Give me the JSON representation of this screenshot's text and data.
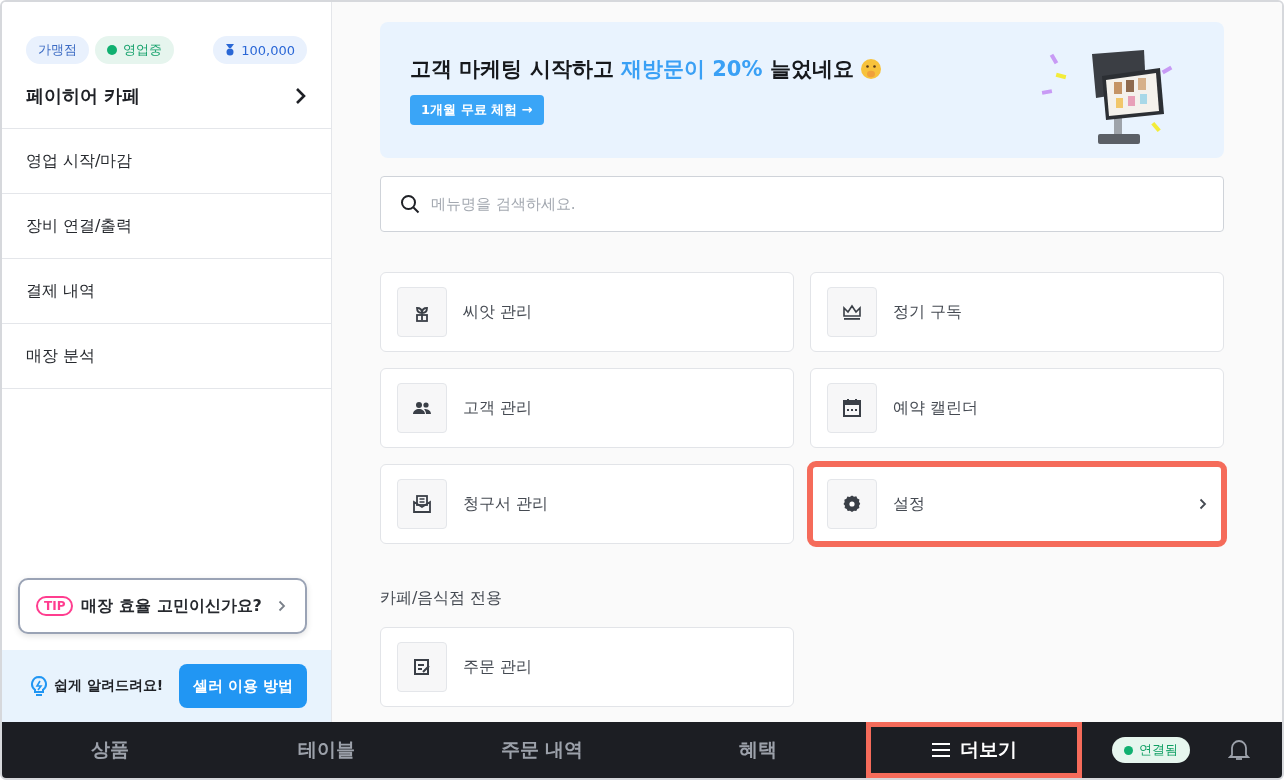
{
  "sidebar": {
    "store_type": "가맹점",
    "business_status": {
      "label": "영업중",
      "open": true
    },
    "points": "100,000",
    "store_name": "페이히어 카페",
    "menu": [
      "영업 시작/마감",
      "장비 연결/출력",
      "결제 내역",
      "매장 분석"
    ],
    "tip": {
      "badge": "TIP",
      "text": "매장 효율 고민이신가요?"
    },
    "help": {
      "text": "쉽게 알려드려요!",
      "button": "셀러 이용 방법"
    }
  },
  "banner": {
    "headline": "고객 마케팅 시작하고",
    "highlight": "재방문이 20%",
    "tail": "늘었네요",
    "button": "1개월 무료 체험 →"
  },
  "search": {
    "placeholder": "메뉴명을 검색하세요."
  },
  "menu_items": [
    {
      "label": "씨앗 관리",
      "highlighted": false
    },
    {
      "label": "정기 구독",
      "highlighted": false
    },
    {
      "label": "고객 관리",
      "highlighted": false
    },
    {
      "label": "예약 캘린더",
      "highlighted": false
    },
    {
      "label": "청구서 관리",
      "highlighted": false
    },
    {
      "label": "설정",
      "highlighted": true
    }
  ],
  "section": {
    "title": "카페/음식점 전용",
    "items": [
      {
        "label": "주문 관리",
        "highlighted": false
      }
    ]
  },
  "bottom_nav": {
    "tabs": [
      {
        "label": "상품",
        "selected": false
      },
      {
        "label": "테이블",
        "selected": false
      },
      {
        "label": "주문 내역",
        "selected": false
      },
      {
        "label": "혜택",
        "selected": false
      },
      {
        "label": "더보기",
        "selected": true
      }
    ],
    "connection": {
      "label": "연결됨",
      "connected": true
    }
  }
}
